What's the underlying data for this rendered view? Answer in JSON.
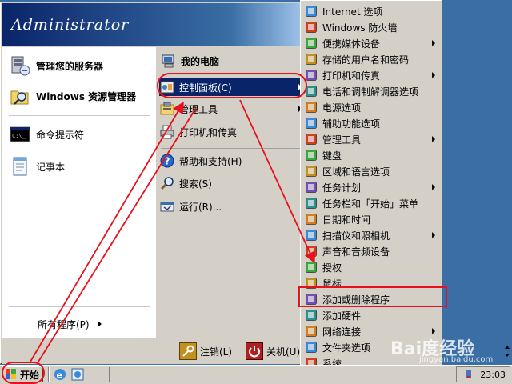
{
  "start_menu": {
    "user_name": "Administrator",
    "left_items": [
      {
        "label": "管理您的服务器",
        "icon": "server-manage-icon"
      },
      {
        "label": "Windows 资源管理器",
        "icon": "folder-magnifier-icon"
      },
      {
        "label": "命令提示符",
        "icon": "cmd-icon"
      },
      {
        "label": "记事本",
        "icon": "notepad-icon"
      }
    ],
    "all_programs_label": "所有程序(P)",
    "right_items": [
      {
        "label": "我的电脑",
        "icon": "my-computer-icon",
        "bold": true
      },
      {
        "label": "控制面板(C)",
        "icon": "control-panel-icon",
        "selected": true,
        "submenu": true
      },
      {
        "label": "管理工具",
        "icon": "admin-tools-icon",
        "submenu": true
      },
      {
        "label": "打印机和传真",
        "icon": "printer-icon"
      },
      {
        "label": "帮助和支持(H)",
        "icon": "help-icon"
      },
      {
        "label": "搜索(S)",
        "icon": "search-icon"
      },
      {
        "label": "运行(R)...",
        "icon": "run-icon"
      }
    ],
    "logoff_label": "注销(L)",
    "shutdown_label": "关机(U)"
  },
  "control_panel_submenu": {
    "items": [
      {
        "label": "Internet 选项",
        "icon": "internet-options-icon"
      },
      {
        "label": "Windows 防火墙",
        "icon": "firewall-icon"
      },
      {
        "label": "便携媒体设备",
        "icon": "portable-media-icon",
        "submenu": true
      },
      {
        "label": "存储的用户名和密码",
        "icon": "stored-credentials-icon"
      },
      {
        "label": "打印机和传真",
        "icon": "printer-icon",
        "submenu": true
      },
      {
        "label": "电话和调制解调器选项",
        "icon": "phone-modem-icon"
      },
      {
        "label": "电源选项",
        "icon": "power-options-icon"
      },
      {
        "label": "辅助功能选项",
        "icon": "accessibility-icon"
      },
      {
        "label": "管理工具",
        "icon": "admin-tools-icon",
        "submenu": true
      },
      {
        "label": "键盘",
        "icon": "keyboard-icon"
      },
      {
        "label": "区域和语言选项",
        "icon": "region-language-icon"
      },
      {
        "label": "任务计划",
        "icon": "scheduled-tasks-icon",
        "submenu": true
      },
      {
        "label": "任务栏和「开始」菜单",
        "icon": "taskbar-start-icon"
      },
      {
        "label": "日期和时间",
        "icon": "date-time-icon"
      },
      {
        "label": "扫描仪和照相机",
        "icon": "scanner-camera-icon",
        "submenu": true
      },
      {
        "label": "声音和音频设备",
        "icon": "sound-audio-icon"
      },
      {
        "label": "授权",
        "icon": "licensing-icon"
      },
      {
        "label": "鼠标",
        "icon": "mouse-icon"
      },
      {
        "label": "添加或删除程序",
        "icon": "add-remove-programs-icon"
      },
      {
        "label": "添加硬件",
        "icon": "add-hardware-icon"
      },
      {
        "label": "网络连接",
        "icon": "network-connections-icon",
        "submenu": true
      },
      {
        "label": "文件夹选项",
        "icon": "folder-options-icon"
      },
      {
        "label": "系统",
        "icon": "system-icon"
      }
    ]
  },
  "taskbar": {
    "start_label": "开始",
    "clock": "23:03"
  },
  "watermark": {
    "text": "Bai度经验",
    "sub": "jingyan.baidu.com"
  },
  "colors": {
    "desktop": "#3a6ea5",
    "selection": "#0a246a",
    "annotation_red": "#e8101a"
  }
}
